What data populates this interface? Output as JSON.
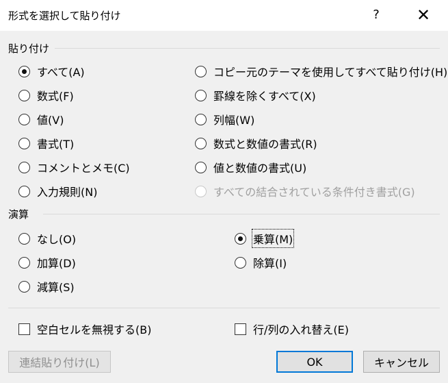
{
  "window": {
    "title": "形式を選択して貼り付け",
    "help_label": "?",
    "close_label": "✕"
  },
  "paste": {
    "label": "貼り付け",
    "left_options": [
      {
        "label": "すべて(A)",
        "checked": true
      },
      {
        "label": "数式(F)",
        "checked": false
      },
      {
        "label": "値(V)",
        "checked": false
      },
      {
        "label": "書式(T)",
        "checked": false
      },
      {
        "label": "コメントとメモ(C)",
        "checked": false
      },
      {
        "label": "入力規則(N)",
        "checked": false
      }
    ],
    "right_options": [
      {
        "label": "コピー元のテーマを使用してすべて貼り付け(H)",
        "checked": false
      },
      {
        "label": "罫線を除くすべて(X)",
        "checked": false
      },
      {
        "label": "列幅(W)",
        "checked": false
      },
      {
        "label": "数式と数値の書式(R)",
        "checked": false
      },
      {
        "label": "値と数値の書式(U)",
        "checked": false
      },
      {
        "label": "すべての結合されている条件付き書式(G)",
        "checked": false,
        "disabled": true
      }
    ]
  },
  "operation": {
    "label": "演算",
    "left_options": [
      {
        "label": "なし(O)",
        "checked": false
      },
      {
        "label": "加算(D)",
        "checked": false
      },
      {
        "label": "減算(S)",
        "checked": false
      }
    ],
    "right_options": [
      {
        "label": "乗算(M)",
        "checked": true
      },
      {
        "label": "除算(I)",
        "checked": false
      }
    ]
  },
  "checkboxes": {
    "skip_blanks": {
      "label": "空白セルを無視する(B)",
      "checked": false
    },
    "transpose": {
      "label": "行/列の入れ替え(E)",
      "checked": false
    }
  },
  "buttons": {
    "paste_link": "連結貼り付け(L)",
    "ok": "OK",
    "cancel": "キャンセル"
  }
}
